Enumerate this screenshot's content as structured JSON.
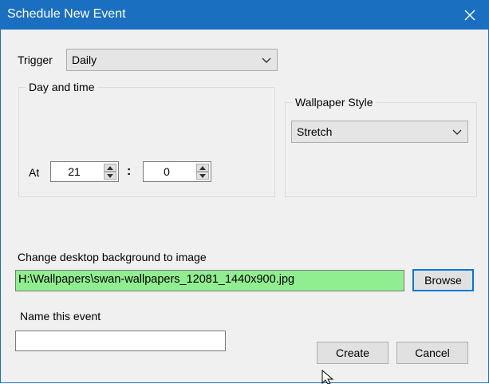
{
  "window": {
    "title": "Schedule New Event",
    "accent_color": "#1a6fc0",
    "close_icon": "close-icon"
  },
  "trigger": {
    "label": "Trigger",
    "selected": "Daily"
  },
  "day_and_time": {
    "group_label": "Day and time",
    "at_label": "At",
    "hour": "21",
    "separator": ":",
    "minute": "0"
  },
  "wallpaper_style": {
    "group_label": "Wallpaper Style",
    "selected": "Stretch"
  },
  "image": {
    "label": "Change desktop background to image",
    "path": "H:\\Wallpapers\\swan-wallpapers_12081_1440x900.jpg",
    "browse_label": "Browse",
    "highlight_color": "#90ee90"
  },
  "event_name": {
    "label": "Name this event",
    "value": ""
  },
  "actions": {
    "create_label": "Create",
    "cancel_label": "Cancel"
  }
}
